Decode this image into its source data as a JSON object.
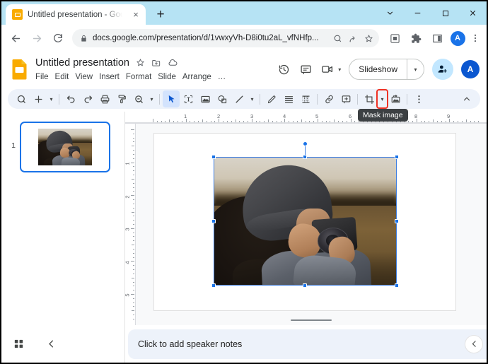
{
  "browser": {
    "tab": {
      "title": "Untitled presentation - Google S",
      "favicon_name": "slides-favicon",
      "close_label": "×"
    },
    "new_tab_label": "+",
    "window_controls": {
      "tab_search": "tab-search",
      "minimize": "minimize",
      "maximize": "maximize",
      "close": "close"
    },
    "nav": {
      "back": "back",
      "forward": "forward",
      "reload": "reload"
    },
    "omnibox": {
      "url": "docs.google.com/presentation/d/1vwxyVh-D8i0tu2aL_vfNHfp...",
      "lock_icon": "lock-icon",
      "search_icon": "search-icon",
      "share_icon": "share-icon",
      "bookmark_icon": "bookmark-star-icon"
    },
    "toolbar_icons": {
      "qr": "qr-scan-icon",
      "extensions": "extensions-puzzle-icon",
      "split_view": "split-view-icon",
      "profile_initial": "A",
      "menu": "three-dot-menu-icon"
    }
  },
  "slides": {
    "doc_title": "Untitled presentation",
    "title_icons": [
      "star-icon",
      "move-to-folder-icon",
      "cloud-saved-icon"
    ],
    "menus": [
      "File",
      "Edit",
      "View",
      "Insert",
      "Format",
      "Slide",
      "Arrange",
      "…"
    ],
    "header_right": {
      "history_icon": "version-history-icon",
      "comment_icon": "comment-icon",
      "meet_icon": "meet-camera-icon",
      "meet_caret": "▾",
      "slideshow_label": "Slideshow",
      "slideshow_caret": "▾",
      "share_icon": "share-person-add-icon",
      "account_initial": "A"
    },
    "toolbar": [
      {
        "name": "search-icon",
        "type": "icon"
      },
      {
        "name": "new-slide-icon",
        "type": "icon"
      },
      {
        "name": "new-slide-caret",
        "type": "caret",
        "glyph": "▾"
      },
      {
        "name": "separator",
        "type": "sep"
      },
      {
        "name": "undo-icon",
        "type": "icon"
      },
      {
        "name": "redo-icon",
        "type": "icon"
      },
      {
        "name": "print-icon",
        "type": "icon"
      },
      {
        "name": "paint-format-icon",
        "type": "icon"
      },
      {
        "name": "zoom-icon",
        "type": "icon"
      },
      {
        "name": "zoom-caret",
        "type": "caret",
        "glyph": "▾"
      },
      {
        "name": "separator",
        "type": "sep"
      },
      {
        "name": "select-cursor-icon",
        "type": "icon",
        "selected": true
      },
      {
        "name": "text-box-icon",
        "type": "icon"
      },
      {
        "name": "insert-image-icon",
        "type": "icon"
      },
      {
        "name": "shape-icon",
        "type": "icon"
      },
      {
        "name": "line-icon",
        "type": "icon"
      },
      {
        "name": "line-caret",
        "type": "caret",
        "glyph": "▾"
      },
      {
        "name": "separator",
        "type": "sep"
      },
      {
        "name": "pen-icon",
        "type": "icon"
      },
      {
        "name": "text-align-icon",
        "type": "icon"
      },
      {
        "name": "table-borders-icon",
        "type": "icon"
      },
      {
        "name": "separator",
        "type": "sep"
      },
      {
        "name": "insert-link-icon",
        "type": "icon"
      },
      {
        "name": "add-comment-icon",
        "type": "icon"
      },
      {
        "name": "separator",
        "type": "sep"
      },
      {
        "name": "crop-image-icon",
        "type": "icon"
      },
      {
        "name": "mask-image-caret",
        "type": "caret",
        "glyph": "▾",
        "highlighted": true
      },
      {
        "name": "replace-image-icon",
        "type": "icon"
      },
      {
        "name": "separator",
        "type": "sep"
      },
      {
        "name": "more-options-icon",
        "type": "icon"
      }
    ],
    "toolbar_collapse_icon": "collapse-toolbar-chevron-icon",
    "tooltip": "Mask image",
    "filmstrip": {
      "slides": [
        {
          "number": "1",
          "selected": true
        }
      ]
    },
    "ruler": {
      "horizontal_numbers": [
        "1",
        "2",
        "3",
        "4",
        "5",
        "6",
        "7",
        "8",
        "9"
      ],
      "vertical_numbers": [
        "1",
        "2",
        "3",
        "4",
        "5"
      ]
    },
    "selected_object": {
      "name": "photographer-image",
      "handles": 8,
      "rotation_handle": true
    },
    "notes": {
      "placeholder": "Click to add speaker notes",
      "collapse_icon": "collapse-notes-chevron-icon"
    },
    "bottom_left": {
      "grid_view_icon": "grid-view-icon",
      "collapse_filmstrip_icon": "collapse-filmstrip-chevron-icon"
    }
  },
  "colors": {
    "browser_titlebar": "#b6e3f4",
    "accent_blue": "#1a73e8",
    "toolbar_bg": "#edf2fa",
    "highlight_red": "#ef3124",
    "slides_orange": "#f9ab00",
    "selection_blue": "#3b7ce0"
  }
}
